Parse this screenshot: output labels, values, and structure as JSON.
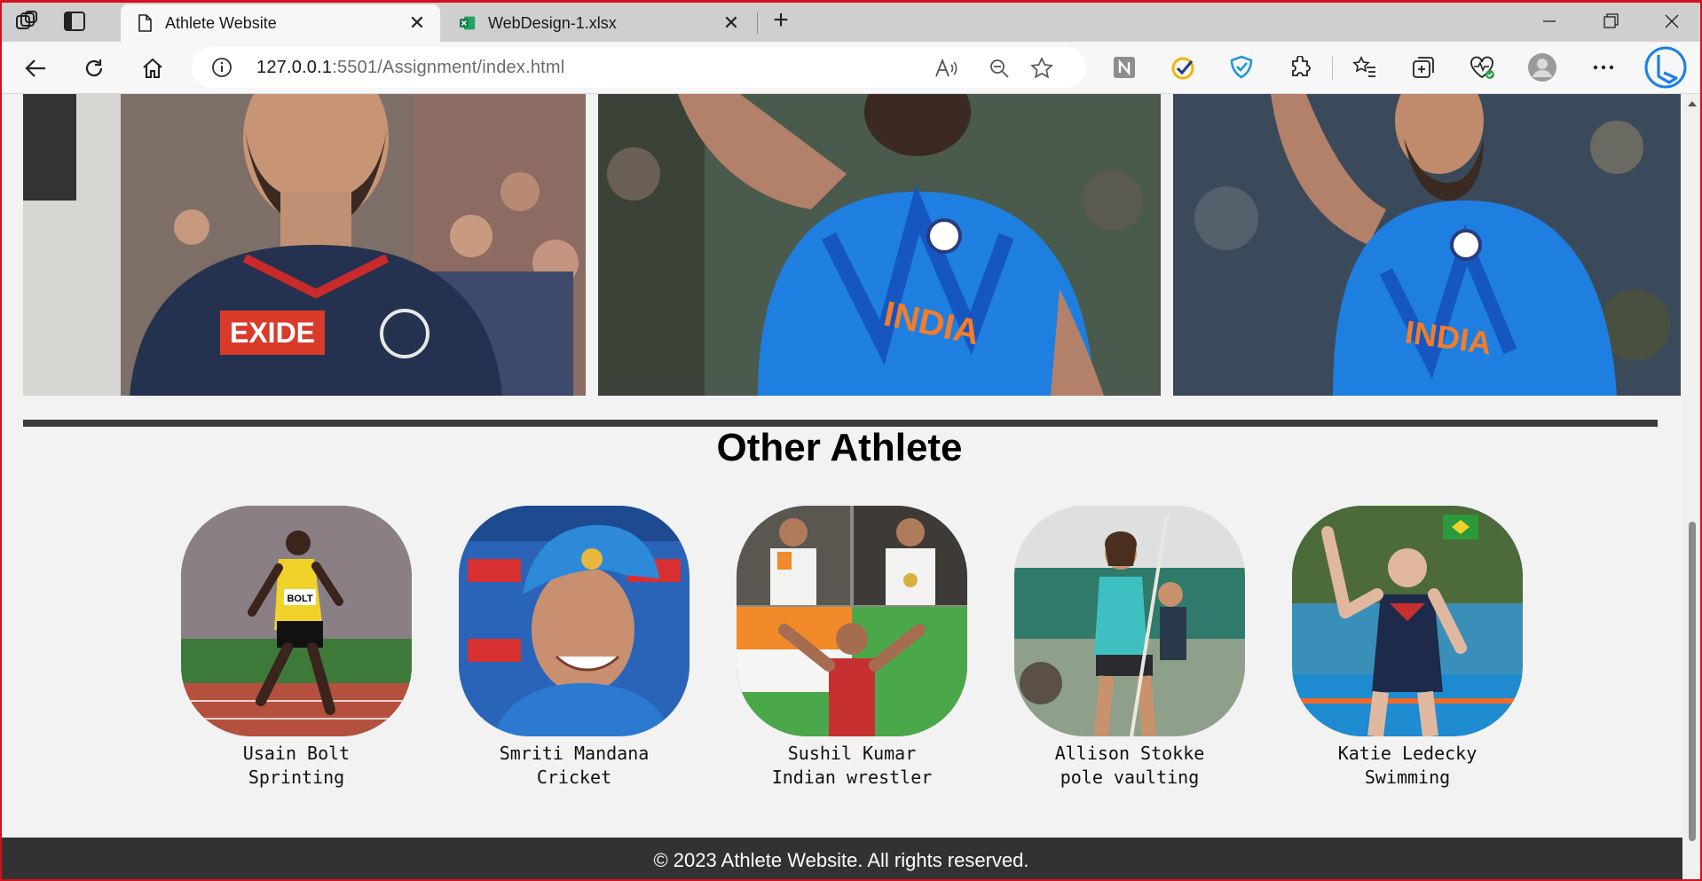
{
  "browser": {
    "tabs": [
      {
        "title": "Athlete Website",
        "active": true,
        "icon": "page-icon"
      },
      {
        "title": "WebDesign-1.xlsx",
        "active": false,
        "icon": "excel-icon"
      }
    ],
    "url_host": "127.0.0.1",
    "url_rest": ":5501/Assignment/index.html",
    "accent_color": "#d4101f"
  },
  "page": {
    "section_title": "Other Athlete",
    "athletes": [
      {
        "name": "Usain Bolt",
        "sport": "Sprinting"
      },
      {
        "name": "Smriti Mandana",
        "sport": "Cricket"
      },
      {
        "name": "Sushil Kumar",
        "sport": "Indian wrestler"
      },
      {
        "name": "Allison Stokke",
        "sport": "pole vaulting"
      },
      {
        "name": "Katie Ledecky",
        "sport": "Swimming"
      }
    ],
    "footer": "© 2023 Athlete Website. All rights reserved."
  }
}
